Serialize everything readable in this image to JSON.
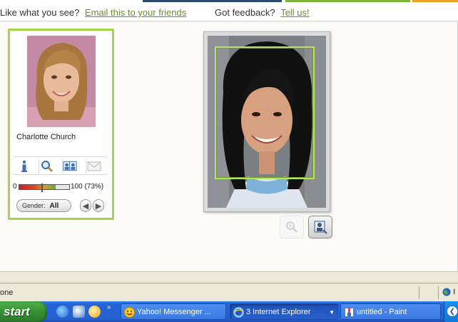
{
  "feedback_bar": {
    "prompt": "Like what you see?",
    "email_link": "Email this to your friends",
    "feedback_prompt": "Got feedback?",
    "tell_us_link": "Tell us!"
  },
  "celebrity": {
    "name": "Charlotte Church",
    "match": {
      "min_label": "0",
      "max_label": "100 (73%)",
      "percent": 73
    },
    "gender_label": "Gender:",
    "gender_value": "All",
    "tools": [
      "info-icon",
      "search-icon",
      "compare-faces-icon",
      "email-icon"
    ]
  },
  "status_bar": {
    "text": "one",
    "zone_text": "I"
  },
  "taskbar": {
    "start_label": "start",
    "tasks": [
      {
        "label": "Yahoo! Messenger ...",
        "icon": "yahoo-messenger-icon"
      },
      {
        "label": "3 Internet Explorer",
        "icon": "internet-explorer-icon",
        "active": true
      },
      {
        "label": "untitled - Paint",
        "icon": "paint-icon"
      }
    ],
    "quick_launch": [
      "internet-explorer-icon",
      "outlook-icon",
      "media-player-icon"
    ],
    "more_label": "»"
  },
  "colors": {
    "accent_green": "#a2d44a",
    "link": "#6b8e23",
    "xp_blue": "#2461d0",
    "start_green": "#348f32"
  }
}
